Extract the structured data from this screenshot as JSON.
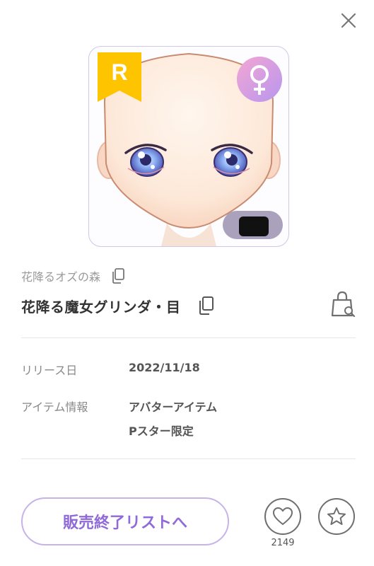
{
  "item": {
    "rarity": "R",
    "gender_symbol": "♀",
    "brand": "花降るオズの森",
    "name": "花降る魔女グリンダ・目"
  },
  "info": {
    "release_label": "リリース日",
    "release_value": "2022/11/18",
    "item_info_label": "アイテム情報",
    "item_info_values": [
      "アバターアイテム",
      "Pスター限定"
    ]
  },
  "actions": {
    "main_button_label": "販売終了リストへ",
    "like_count": "2149"
  },
  "colors": {
    "accent": "#8f6ad8",
    "rank_badge": "#ffc400",
    "gender_gradient_start": "#f4a6d2",
    "gender_gradient_end": "#b796f0"
  },
  "icons": [
    "close-icon",
    "copy-icon",
    "shopping-bag-search-icon",
    "heart-icon",
    "star-icon"
  ]
}
